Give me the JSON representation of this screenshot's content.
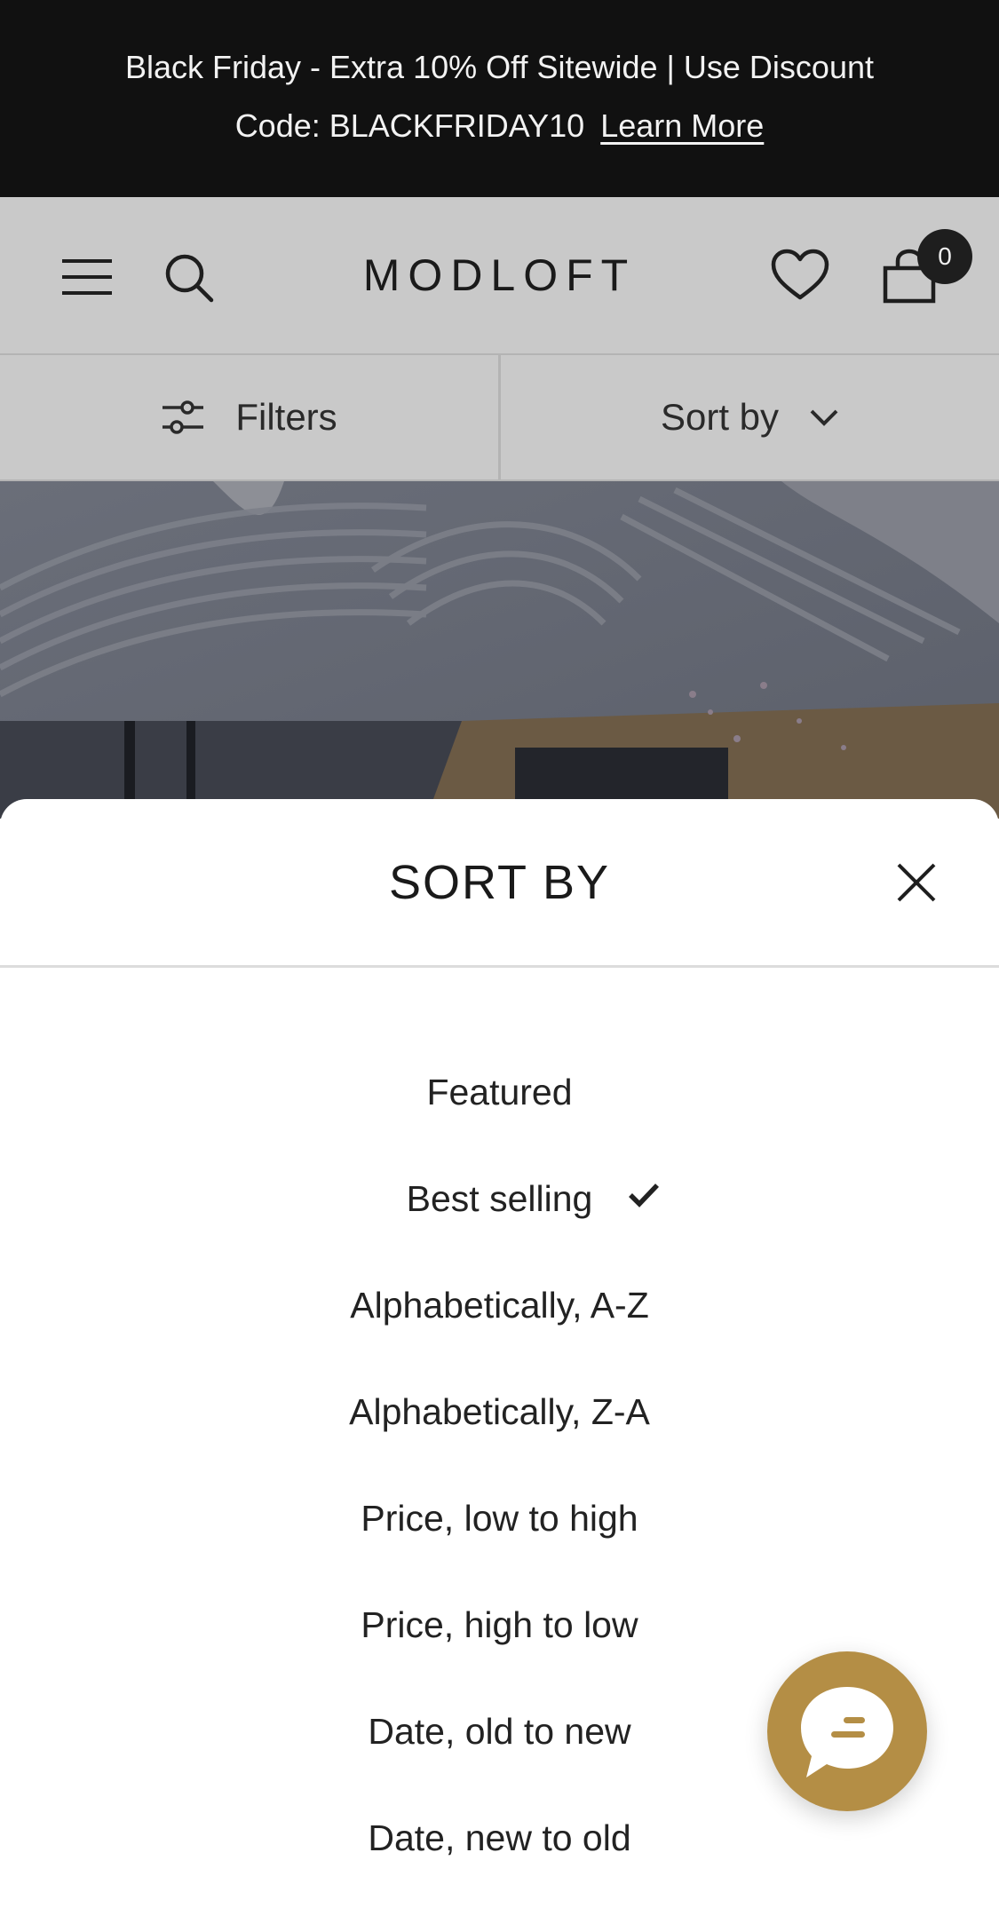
{
  "announcement": {
    "line1": "Black Friday - Extra 10% Off Sitewide | Use Discount",
    "line2": "Code: BLACKFRIDAY10",
    "link": "Learn More"
  },
  "header": {
    "logo": "MODLOFT",
    "cart_count": "0",
    "icons": [
      "menu-icon",
      "search-icon",
      "heart-icon",
      "bag-icon"
    ]
  },
  "toolbar": {
    "filters_label": "Filters",
    "sort_label": "Sort by"
  },
  "sort_sheet": {
    "title": "SORT BY",
    "selected": "Best selling",
    "options": [
      "Featured",
      "Best selling",
      "Alphabetically, A-Z",
      "Alphabetically, Z-A",
      "Price, low to high",
      "Price, high to low",
      "Date, old to new",
      "Date, new to old"
    ]
  },
  "colors": {
    "announcement_bg": "#111111",
    "chat_accent": "#b48e45",
    "dim_header": "#c9c9c9"
  }
}
